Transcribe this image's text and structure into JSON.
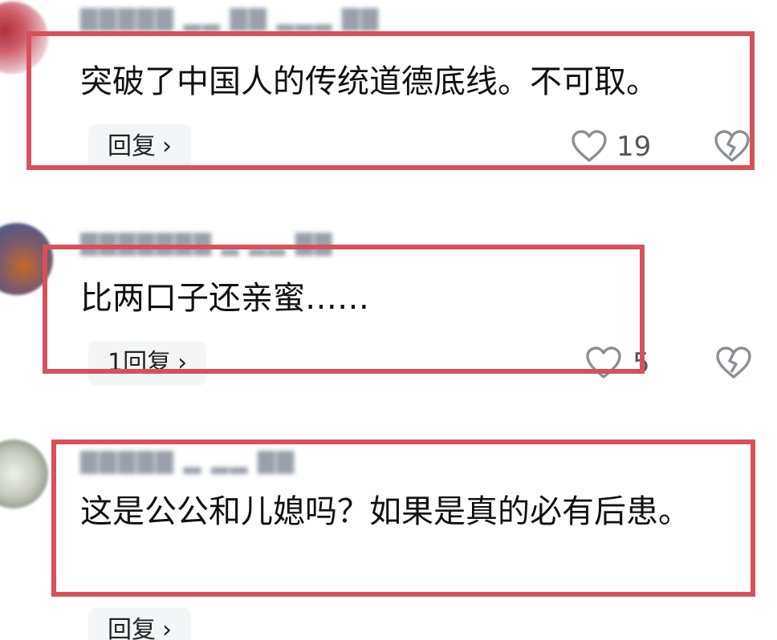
{
  "comments": [
    {
      "text": "突破了中国人的传统道德底线。不可取。",
      "reply_label": "回复",
      "like_count": "19"
    },
    {
      "text": "比两口子还亲蜜……",
      "reply_label": "1回复",
      "like_count": "5"
    },
    {
      "text": "这是公公和儿媳吗？如果是真的必有后患。",
      "reply_label": "回复"
    }
  ],
  "highlight_color": "#d8505c",
  "icons": {
    "like": "heart-outline-icon",
    "dislike": "broken-heart-icon",
    "reply_arrow": "chevron-right-icon"
  }
}
